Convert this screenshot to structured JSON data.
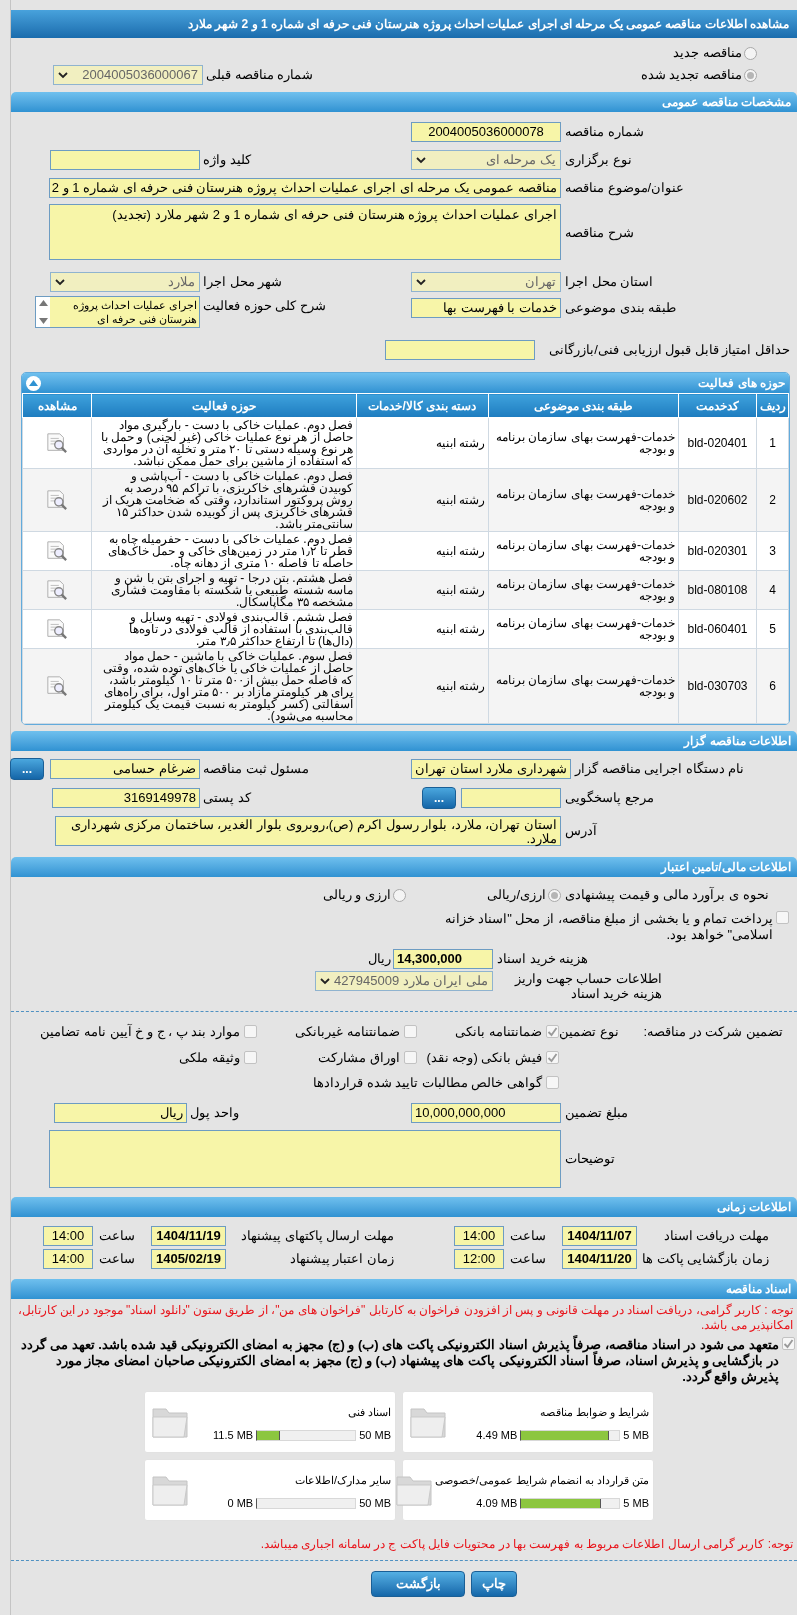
{
  "title": "مشاهده اطلاعات مناقصه عمومی یک مرحله ای اجرای عملیات احداث پروژه هنرستان فنی حرفه ای شماره 1 و 2 شهر ملارد",
  "tender_type": [
    {
      "label": "مناقصه جدید",
      "selected": false
    },
    {
      "label": "مناقصه تجدید شده",
      "selected": true
    }
  ],
  "previous_tender": {
    "label": "شماره مناقصه قبلی",
    "value": "2004005036000067"
  },
  "general": {
    "header": "مشخصات مناقصه عمومی",
    "number": {
      "label": "شماره مناقصه",
      "value": "2004005036000078"
    },
    "holding_type": {
      "label": "نوع برگزاری",
      "value": "یک مرحله ای"
    },
    "keyword": {
      "label": "کلید واژه"
    },
    "subject": {
      "label": "عنوان/موضوع مناقصه",
      "value": "مناقصه عمومی یک مرحله ای اجرای عملیات احداث پروژه هنرستان فنی حرفه ای شماره 1 و 2"
    },
    "description": {
      "label": "شرح مناقصه",
      "value": "اجرای عملیات احداث پروژه هنرستان فنی حرفه ای شماره 1 و 2 شهر ملارد (تجدید)"
    },
    "province": {
      "label": "استان محل اجرا",
      "value": "تهران"
    },
    "city": {
      "label": "شهر محل اجرا",
      "value": "ملارد"
    },
    "category": {
      "label": "طبقه بندی موضوعی",
      "value": "خدمات با فهرست بها"
    },
    "activity_summary": {
      "label": "شرح کلی حوزه فعالیت",
      "value": "اجرای عملیات احداث پروژه هنرستان فنی حرفه ای"
    },
    "min_score": {
      "label": "حداقل امتیاز قابل قبول ارزیابی فنی/بازرگانی"
    }
  },
  "activities": {
    "header": "حوزه های فعالیت",
    "expanded": true,
    "columns": [
      "ردیف",
      "کدخدمت",
      "طبقه بندی موضوعی",
      "دسته بندی کالا/خدمات",
      "حوزه فعالیت",
      "مشاهده"
    ],
    "rows": [
      {
        "index": "1",
        "code": "bld-020401",
        "category": "خدمات-فهرست بهای سازمان برنامه و بودجه",
        "group": "رشته ابنیه",
        "activity": "فصل دوم. عملیات خاکی با دست - بارگیری مواد حاصل از هر نوع عملیات خاکی (غیر لجنی) و حمل با هر نوع وسیله دستی تا ۲۰ متر و تخلیه آن در مواردی که استفاده از ماشین برای حمل ممکن نباشد."
      },
      {
        "index": "2",
        "code": "bld-020602",
        "category": "خدمات-فهرست بهای سازمان برنامه و بودجه",
        "group": "رشته ابنیه",
        "activity": "فصل دوم. عملیات خاکی با دست - آب‌پاشی و کوبیدن قشرهای خاکریزی، با تراکم ۹۵ درصد به روش پروکتور استاندارد، وقتی که ضخامت هریک از قشرهای خاکریزی پس از کوبیده شدن حداکثر ۱۵ سانتی‌متر باشد."
      },
      {
        "index": "3",
        "code": "bld-020301",
        "category": "خدمات-فهرست بهای سازمان برنامه و بودجه",
        "group": "رشته ابنیه",
        "activity": "فصل دوم. عملیات خاکی با دست - حفرمیله چاه به قطر تا ۱٫۲ متر در زمین‌های خاکی و حمل خاک‌های حاصله تا فاصله ۱۰ متری از دهانه چاه."
      },
      {
        "index": "4",
        "code": "bld-080108",
        "category": "خدمات-فهرست بهای سازمان برنامه و بودجه",
        "group": "رشته ابنیه",
        "activity": "فصل هشتم. بتن درجا - تهیه و اجرای بتن با شن و ماسه شسته طبیعی یا شکسته با مقاومت فشاری مشخصه ۳۵ مگاپاسکال."
      },
      {
        "index": "5",
        "code": "bld-060401",
        "category": "خدمات-فهرست بهای سازمان برنامه و بودجه",
        "group": "رشته ابنیه",
        "activity": "فصل ششم. قالب‌بندی فولادی - تهیه وسایل و قالب‌بندی با استفاده از قالب فولادی در تاوه‌ها (دال‌ها) تا ارتفاع حداکثر ۳٫۵ متر."
      },
      {
        "index": "6",
        "code": "bld-030703",
        "category": "خدمات-فهرست بهای سازمان برنامه و بودجه",
        "group": "رشته ابنیه",
        "activity": "فصل سوم. عملیات خاکی با ماشین - حمل مواد حاصل از عملیات خاکی یا خاک‌های توده شده، وقتی که فاصله حمل بیش از۵۰۰ متر تا ۱۰ کیلومتر باشد، برای هر کیلومتر مازاد بر ۵۰۰ متر اول، برای راه‌های آسفالتی (کسر کیلومتر به نسبت قیمت یک کیلومتر محاسبه می‌شود)."
      }
    ]
  },
  "organizer": {
    "header": "اطلاعات مناقصه گزار",
    "agency": {
      "label": "نام دستگاه اجرایی مناقصه گزار",
      "value": "شهرداری ملارد استان تهران"
    },
    "registrar": {
      "label": "مسئول ثبت مناقصه",
      "value": "ضرغام حسامی",
      "button": "..."
    },
    "reference": {
      "label": "مرجع پاسخگویی",
      "button": "..."
    },
    "postal_code": {
      "label": "کد پستی",
      "value": "3169149978"
    },
    "address": {
      "label": "آدرس",
      "value": "استان تهران، ملارد، بلوار رسول اکرم (ص)،روبروی بلوار الغدیر، ساختمان مرکزی شهرداری ملارد."
    }
  },
  "finance": {
    "header": "اطلاعات مالی/تامین اعتبار",
    "estimate_label": "نحوه ی برآورد مالی و قیمت پیشنهادی",
    "estimate_options": [
      {
        "label": "ارزی/ریالی",
        "selected": true
      },
      {
        "label": "ارزی و ریالی",
        "selected": false
      }
    ],
    "treasury": {
      "label": "پرداخت تمام و یا بخشی از مبلغ مناقصه، از محل \"اسناد خزانه اسلامی\" خواهد بود.",
      "checked": false
    },
    "doc_cost": {
      "label": "هزینه خرید اسناد",
      "value": "14,300,000",
      "unit": "ریال"
    },
    "account": {
      "label": "اطلاعات حساب جهت واریز هزینه خرید اسناد",
      "value": "ملی ایران ملارد 427945009"
    }
  },
  "guarantee": {
    "label": "تضمین شرکت در مناقصه:",
    "type_label": "نوع تضمین",
    "options": [
      {
        "label": "ضمانتنامه بانکی",
        "checked": true
      },
      {
        "label": "ضمانتنامه غیربانکی",
        "checked": false
      },
      {
        "label": "موارد بند پ ، ج و خ آیین نامه تضامین",
        "checked": false
      },
      {
        "label": "فیش بانکی (وجه نقد)",
        "checked": true
      },
      {
        "label": "اوراق مشارکت",
        "checked": false
      },
      {
        "label": "وثیقه ملکی",
        "checked": false
      },
      {
        "label": "گواهی خالص مطالبات تایید شده قراردادها",
        "checked": false
      }
    ],
    "amount": {
      "label": "مبلغ تضمین",
      "value": "10,000,000,000"
    },
    "currency": {
      "label": "واحد پول",
      "value": "ریال"
    },
    "notes": {
      "label": "توضیحات"
    }
  },
  "timing": {
    "header": "اطلاعات زمانی",
    "items": [
      {
        "label": "مهلت دریافت اسناد",
        "date": "1404/11/07",
        "time_label": "ساعت",
        "time": "14:00"
      },
      {
        "label": "مهلت ارسال پاکتهای پیشنهاد",
        "date": "1404/11/19",
        "time_label": "ساعت",
        "time": "14:00"
      },
      {
        "label": "زمان بازگشایی پاکت ها",
        "date": "1404/11/20",
        "time_label": "ساعت",
        "time": "12:00"
      },
      {
        "label": "زمان اعتبار پیشنهاد",
        "date": "1405/02/19",
        "time_label": "ساعت",
        "time": "14:00"
      }
    ]
  },
  "documents": {
    "header": "اسناد مناقصه",
    "notice": "توجه : کاربر گرامی، دریافت اسناد در مهلت قانونی و پس از افزودن فراخوان به کارتابل \"فراخوان های من\"، از طریق ستون \"دانلود اسناد\" موجود در این کارتابل، امکانپذیر می باشد.",
    "commitment": {
      "text": "متعهد می شود در اسناد مناقصه، صرفاً پذیرش اسناد الکترونیکی پاکت های (ب) و (ج) مجهز به امضای الکترونیکی قید شده باشد. تعهد می گردد در بازگشایی و پذیرش اسناد، صرفاً اسناد الکترونیکی پاکت های پیشنهاد (ب) و (ج) مجهز به امضای الکترونیکی صاحبان امضای مجاز مورد پذیرش واقع گردد.",
      "checked": true
    },
    "files": [
      {
        "name": "شرایط و ضوابط مناقصه",
        "size": "4.49 MB",
        "limit": "5 MB",
        "level": 0.898
      },
      {
        "name": "اسناد فنی",
        "size": "11.5 MB",
        "limit": "50 MB",
        "level": 0.23
      },
      {
        "name": "متن قرارداد به انضمام شرایط عمومی/خصوصی",
        "size": "4.09 MB",
        "limit": "5 MB",
        "level": 0.818
      },
      {
        "name": "سایر مدارک/اطلاعات",
        "size": "0 MB",
        "limit": "50 MB",
        "level": 0
      }
    ],
    "footer_notice": "توجه: کاربر گرامی ارسال اطلاعات مربوط به فهرست بها در محتویات فایل پاکت ج در سامانه اجباری میباشد."
  },
  "buttons": [
    {
      "label": "چاپ"
    },
    {
      "label": "بازگشت"
    }
  ]
}
